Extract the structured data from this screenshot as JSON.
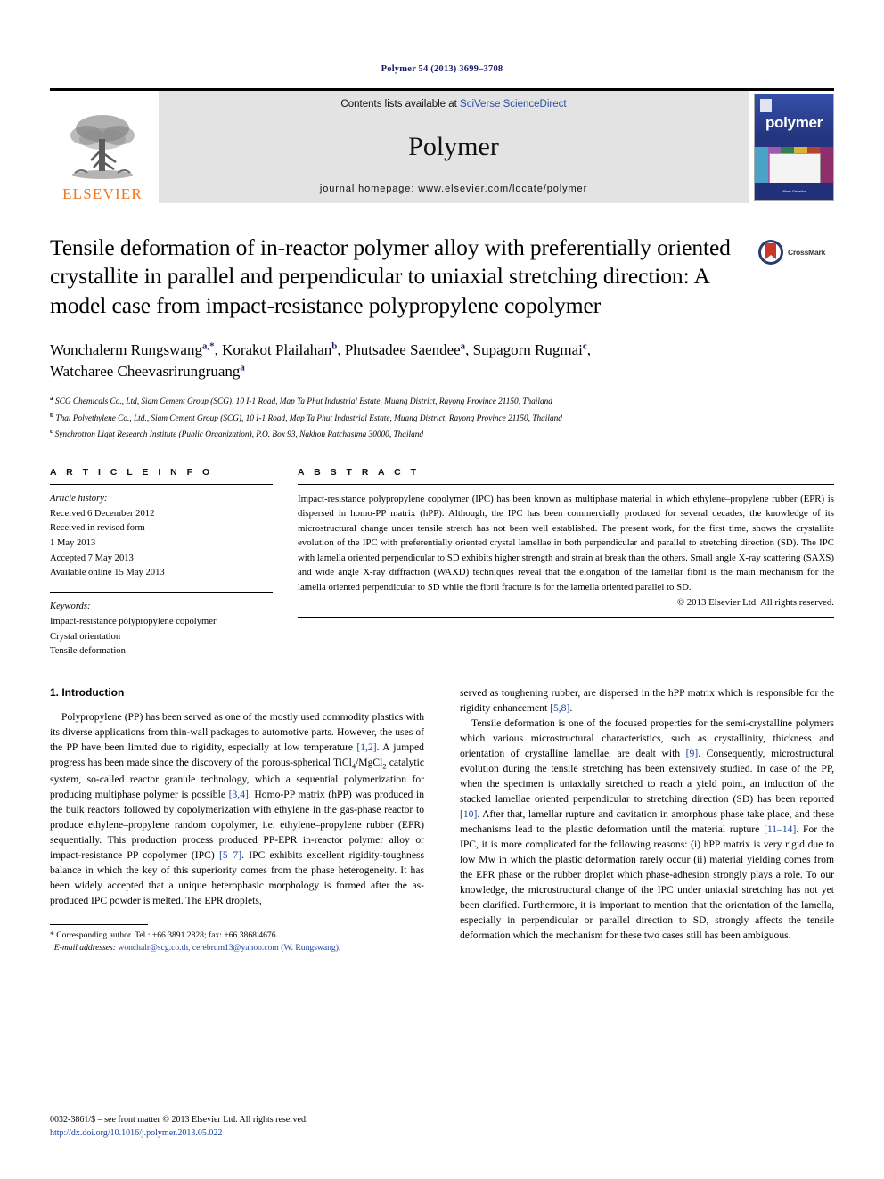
{
  "running_head": "Polymer 54 (2013) 3699–3708",
  "masthead": {
    "publisher": "ELSEVIER",
    "contents_prefix": "Contents lists available at ",
    "contents_link": "SciVerse ScienceDirect",
    "journal_name": "Polymer",
    "homepage": "journal homepage: www.elsevier.com/locate/polymer",
    "cover_title": "polymer",
    "cover_footer": "When Genetics"
  },
  "article": {
    "title": "Tensile deformation of in-reactor polymer alloy with preferentially oriented crystallite in parallel and perpendicular to uniaxial stretching direction: A model case from impact-resistance polypropylene copolymer",
    "crossmark_label": "CrossMark",
    "authors_line_1": "Wonchalerm Rungswang a,*, Korakot Plailahan b, Phutsadee Saendee a, Supagorn Rugmai c,",
    "authors_line_2": "Watcharee Cheevasrirungruang a",
    "authors": [
      {
        "name": "Wonchalerm Rungswang",
        "sup": "a,*"
      },
      {
        "name": "Korakot Plailahan",
        "sup": "b"
      },
      {
        "name": "Phutsadee Saendee",
        "sup": "a"
      },
      {
        "name": "Supagorn Rugmai",
        "sup": "c"
      },
      {
        "name": "Watcharee Cheevasrirungruang",
        "sup": "a"
      }
    ],
    "affiliations": [
      {
        "sup": "a",
        "text": "SCG Chemicals Co., Ltd, Siam Cement Group (SCG), 10 I-1 Road, Map Ta Phut Industrial Estate, Muang District, Rayong Province 21150, Thailand"
      },
      {
        "sup": "b",
        "text": "Thai Polyethylene Co., Ltd., Siam Cement Group (SCG), 10 I-1 Road, Map Ta Phut Industrial Estate, Muang District, Rayong Province 21150, Thailand"
      },
      {
        "sup": "c",
        "text": "Synchrotron Light Research Institute (Public Organization), P.O. Box 93, Nakhon Ratchasima 30000, Thailand"
      }
    ]
  },
  "article_info": {
    "heading": "A R T I C L E    I N F O",
    "history_label": "Article history:",
    "history": [
      "Received 6 December 2012",
      "Received in revised form",
      "1 May 2013",
      "Accepted 7 May 2013",
      "Available online 15 May 2013"
    ],
    "keywords_label": "Keywords:",
    "keywords": [
      "Impact-resistance polypropylene copolymer",
      "Crystal orientation",
      "Tensile deformation"
    ]
  },
  "abstract": {
    "heading": "A B S T R A C T",
    "text": "Impact-resistance polypropylene copolymer (IPC) has been known as multiphase material in which ethylene–propylene rubber (EPR) is dispersed in homo-PP matrix (hPP). Although, the IPC has been commercially produced for several decades, the knowledge of its microstructural change under tensile stretch has not been well established. The present work, for the first time, shows the crystallite evolution of the IPC with preferentially oriented crystal lamellae in both perpendicular and parallel to stretching direction (SD). The IPC with lamella oriented perpendicular to SD exhibits higher strength and strain at break than the others. Small angle X-ray scattering (SAXS) and wide angle X-ray diffraction (WAXD) techniques reveal that the elongation of the lamellar fibril is the main mechanism for the lamella oriented perpendicular to SD while the fibril fracture is for the lamella oriented parallel to SD.",
    "copyright": "© 2013 Elsevier Ltd. All rights reserved."
  },
  "introduction": {
    "section_number_title": "1.  Introduction",
    "left_paragraph_1": "Polypropylene (PP) has been served as one of the mostly used commodity plastics with its diverse applications from thin-wall packages to automotive parts. However, the uses of the PP have been limited due to rigidity, especially at low temperature [1,2]. A jumped progress has been made since the discovery of the porous-spherical TiCl4/MgCl2 catalytic system, so-called reactor granule technology, which a sequential polymerization for producing multiphase polymer is possible [3,4]. Homo-PP matrix (hPP) was produced in the bulk reactors followed by copolymerization with ethylene in the gas-phase reactor to produce ethylene–propylene random copolymer, i.e. ethylene–propylene rubber (EPR) sequentially. This production process produced PP-EPR in-reactor polymer alloy or impact-resistance PP copolymer (IPC) [5–7]. IPC exhibits excellent rigidity-toughness balance in which the key of this superiority comes from the phase heterogeneity. It has been widely accepted that a unique heterophasic morphology is formed after the as-produced IPC powder is melted. The EPR droplets,",
    "right_paragraph_1_cont": "served as toughening rubber, are dispersed in the hPP matrix which is responsible for the rigidity enhancement [5,8].",
    "right_paragraph_2": "Tensile deformation is one of the focused properties for the semi-crystalline polymers which various microstructural characteristics, such as crystallinity, thickness and orientation of crystalline lamellae, are dealt with [9]. Consequently, microstructural evolution during the tensile stretching has been extensively studied. In case of the PP, when the specimen is uniaxially stretched to reach a yield point, an induction of the stacked lamellae oriented perpendicular to stretching direction (SD) has been reported [10]. After that, lamellar rupture and cavitation in amorphous phase take place, and these mechanisms lead to the plastic deformation until the material rupture [11–14]. For the IPC, it is more complicated for the following reasons: (i) hPP matrix is very rigid due to low Mw in which the plastic deformation rarely occur (ii) material yielding comes from the EPR phase or the rubber droplet which phase-adhesion strongly plays a role. To our knowledge, the microstructural change of the IPC under uniaxial stretching has not yet been clarified. Furthermore, it is important to mention that the orientation of the lamella, especially in perpendicular or parallel direction to SD, strongly affects the tensile deformation which the mechanism for these two cases still has been ambiguous."
  },
  "footnote": {
    "corresponding": "* Corresponding author. Tel.: +66 3891 2828; fax: +66 3868 4676.",
    "email_label": "E-mail addresses:",
    "emails": "wonchalr@scg.co.th, cerebrum13@yahoo.com (W. Rungswang)."
  },
  "page_footer": {
    "front_matter": "0032-3861/$ – see front matter © 2013 Elsevier Ltd. All rights reserved.",
    "doi": "http://dx.doi.org/10.1016/j.polymer.2013.05.022"
  },
  "colors": {
    "link_blue": "#1a3fa0",
    "elsevier_orange": "#ef7622",
    "band_grey": "#e3e3e3",
    "cover_blue": "#2b3b8f"
  }
}
